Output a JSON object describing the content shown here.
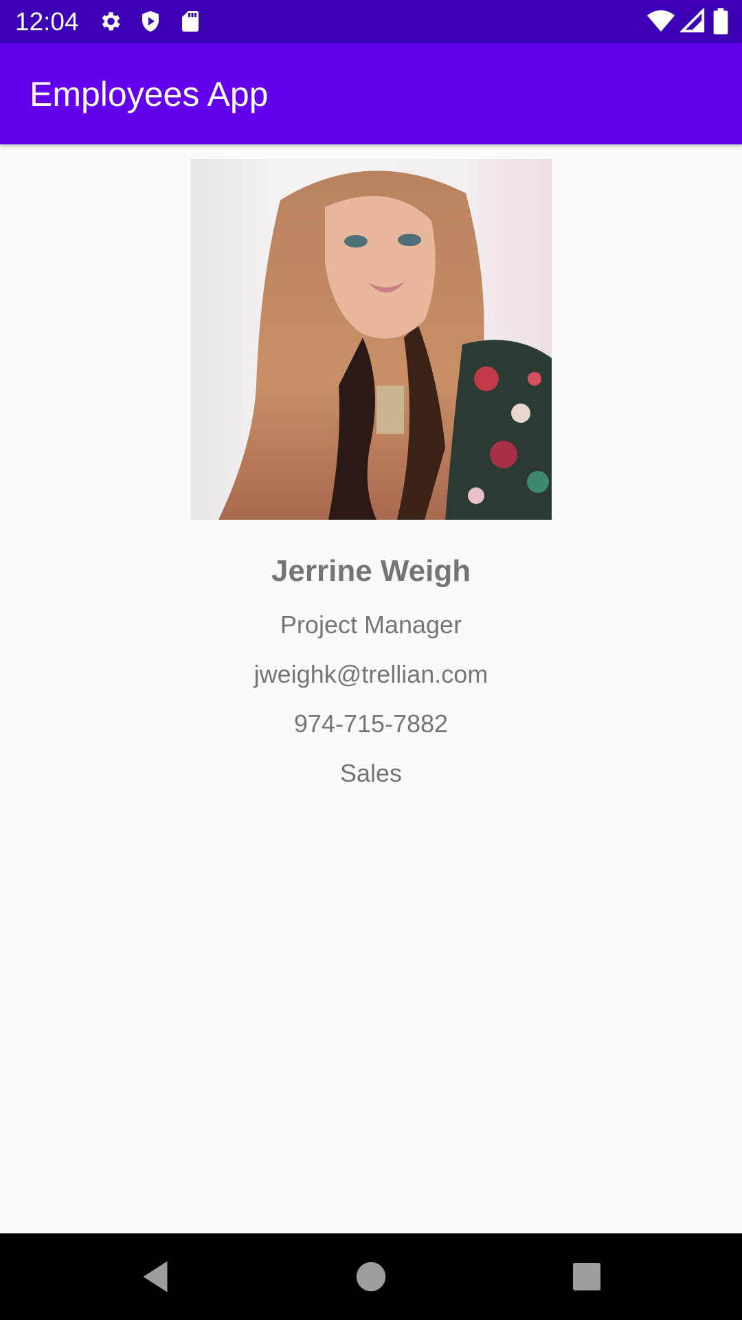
{
  "status_bar": {
    "time": "12:04",
    "background": "#3c00b5",
    "left_icons": [
      "gear-icon",
      "shield-icon",
      "sd-card-icon"
    ],
    "right_icons": [
      "wifi-icon",
      "signal-icon",
      "battery-icon"
    ]
  },
  "app_bar": {
    "title": "Employees App",
    "background": "#6200ee"
  },
  "employee": {
    "photo_icon": "employee-photo",
    "name": "Jerrine Weigh",
    "title": "Project Manager",
    "email": "jweighk@trellian.com",
    "phone": "974-715-7882",
    "department": "Sales"
  },
  "nav_bar": {
    "buttons": [
      "back-icon",
      "home-icon",
      "recents-icon"
    ]
  },
  "colors": {
    "text_secondary": "#757575",
    "background": "#fafafa"
  }
}
